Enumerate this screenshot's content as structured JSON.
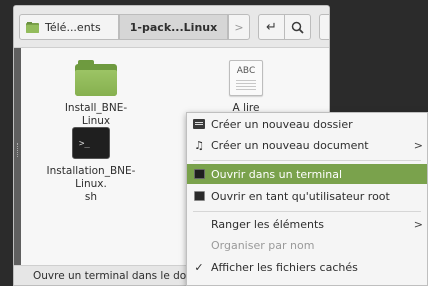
{
  "toolbar": {
    "crumb_home": "Télé...ents",
    "crumb_active": "1-pack...Linux",
    "crumb_next": ">",
    "btn_open_terminal": "↵",
    "btn_search": "🔍"
  },
  "files": [
    {
      "name": "Install_BNE-Linux",
      "icon": "folder-icon"
    },
    {
      "name": "A lire",
      "icon": "text-file-icon",
      "icon_text": "ABC"
    },
    {
      "name": "Installation_BNE-Linux.\nsh",
      "icon": "terminal-script-icon",
      "icon_text": ">_"
    }
  ],
  "statusbar": {
    "text": "Ouvre un terminal dans le dossier"
  },
  "context_menu": {
    "items": [
      {
        "label": "Créer un nouveau dossier",
        "icon": "new-folder-icon"
      },
      {
        "label": "Créer un nouveau document",
        "icon": "new-document-icon",
        "submenu": ">"
      },
      {
        "label": "Ouvrir dans un terminal",
        "icon": "terminal-icon",
        "highlighted": true
      },
      {
        "label": "Ouvrir en tant qu'utilisateur root",
        "icon": "root-terminal-icon"
      },
      {
        "label": "Ranger les éléments",
        "submenu": ">"
      },
      {
        "label": "Organiser par nom",
        "disabled": true
      },
      {
        "label": "Afficher les fichiers cachés",
        "check": "✓"
      }
    ]
  },
  "colors": {
    "accent": "#7aa24c",
    "folder": "#86b04f"
  }
}
